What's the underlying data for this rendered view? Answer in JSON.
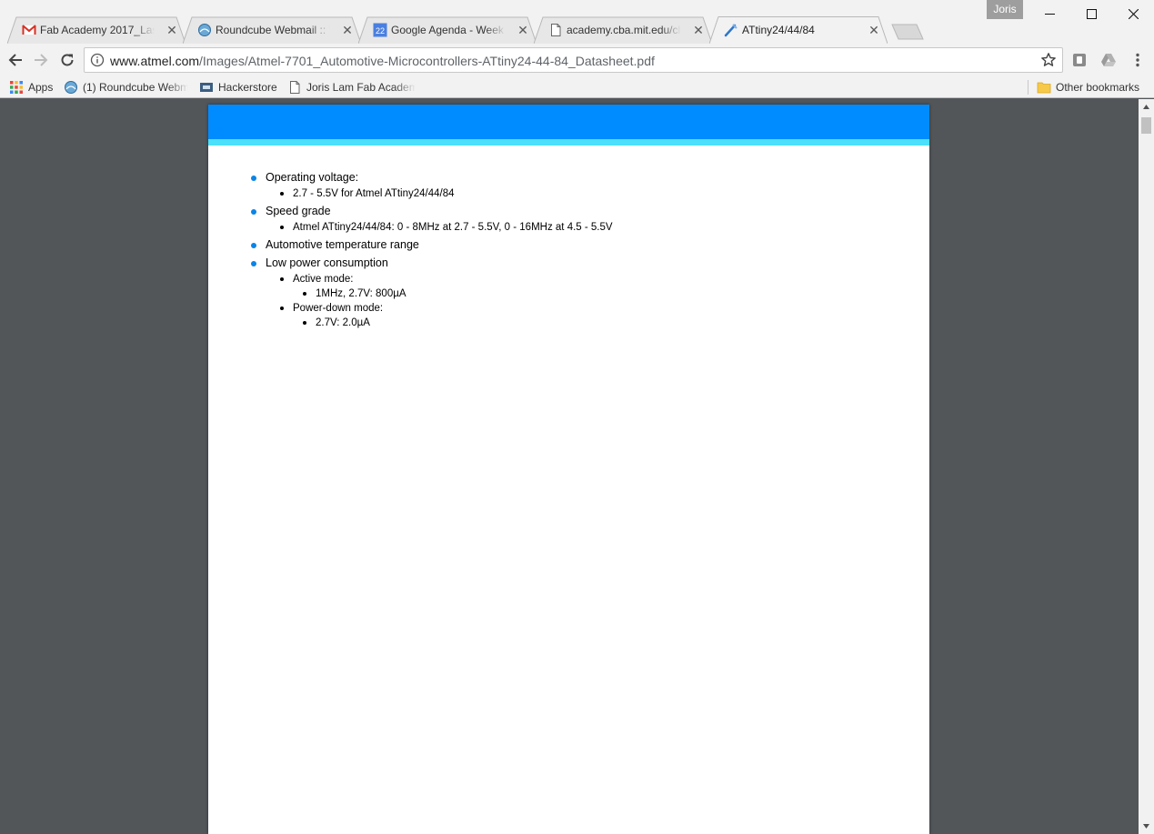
{
  "window": {
    "profile_name": "Joris",
    "controls": [
      "minimize-icon",
      "maximize-icon",
      "close-icon"
    ]
  },
  "tabs": [
    {
      "title": "Fab Academy 2017_Last p",
      "icon": "gmail-icon",
      "active": false
    },
    {
      "title": "Roundcube Webmail :: W",
      "icon": "roundcube-icon",
      "active": false
    },
    {
      "title": "Google Agenda - Week va",
      "icon": "calendar-icon",
      "icon_text": "22",
      "active": false
    },
    {
      "title": "academy.cba.mit.edu/cla",
      "icon": "page-icon",
      "active": false
    },
    {
      "title": "ATtiny24/44/84",
      "icon": "pdf-icon",
      "active": true
    }
  ],
  "toolbar": {
    "url_host": "www.atmel.com",
    "url_path": "/Images/Atmel-7701_Automotive-Microcontrollers-ATtiny24-44-84_Datasheet.pdf",
    "icons": [
      "back-icon",
      "forward-icon",
      "reload-icon",
      "info-icon",
      "star-icon",
      "extension-icon",
      "drive-icon",
      "menu-icon"
    ]
  },
  "bookmarks": {
    "apps": "Apps",
    "items": [
      "(1) Roundcube Webm",
      "Hackerstore",
      "Joris Lam Fab Academ"
    ],
    "other": "Other bookmarks"
  },
  "document": {
    "features": {
      "operating_voltage": {
        "label": "Operating voltage:",
        "detail": "2.7 - 5.5V for Atmel ATtiny24/44/84"
      },
      "speed_grade": {
        "label": "Speed grade",
        "detail": "Atmel ATtiny24/44/84: 0 - 8MHz at 2.7 - 5.5V, 0 - 16MHz at 4.5 - 5.5V"
      },
      "temperature": {
        "label": "Automotive temperature range"
      },
      "power": {
        "label": "Low power consumption",
        "active_mode": "Active mode:",
        "active_value": "1MHz, 2.7V: 800µA",
        "powerdown_mode": "Power-down mode:",
        "powerdown_value": "2.7V: 2.0µA"
      }
    },
    "colors": {
      "header_band": "#008bff",
      "header_stripe": "#4ce0fb",
      "bullet": "#0a84e6"
    }
  }
}
